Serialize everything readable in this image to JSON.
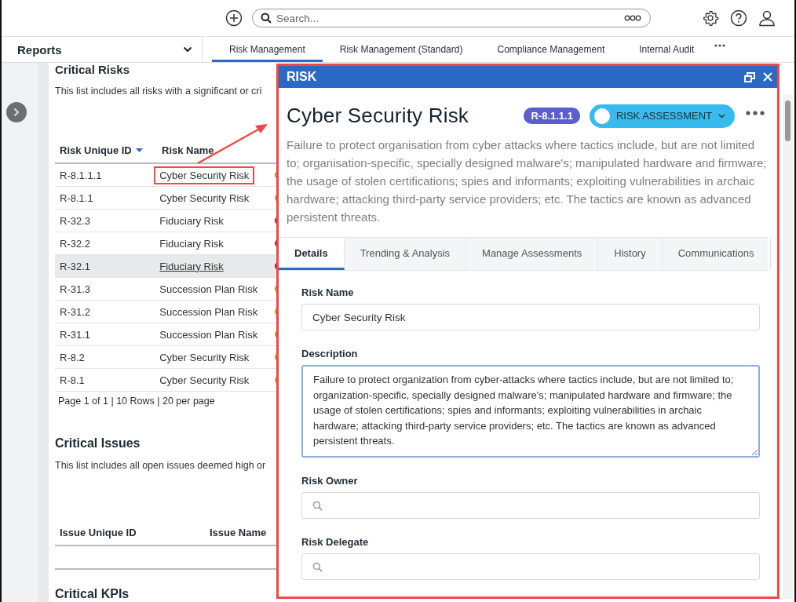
{
  "top_bar": {
    "search": {
      "placeholder": "Search..."
    }
  },
  "nav": {
    "menu": {
      "label": "Reports"
    },
    "tabs": [
      {
        "label": "Risk Management",
        "selected": true
      },
      {
        "label": "Risk Management (Standard)",
        "selected": false
      },
      {
        "label": "Compliance Management",
        "selected": false
      },
      {
        "label": "Internal Audit",
        "selected": false
      }
    ]
  },
  "critical_risks": {
    "title": "Critical Risks",
    "description": "This list includes all risks with a significant or cri",
    "columns": [
      {
        "label": "Risk Unique ID",
        "sorted": true
      },
      {
        "label": "Risk Name",
        "sorted": false
      }
    ],
    "rows": [
      {
        "id": "R-8.1.1.1",
        "name": "Cyber Security Risk",
        "color": "#f0841c",
        "selected": false,
        "annotated": true
      },
      {
        "id": "R-8.1.1",
        "name": "Cyber Security Risk",
        "color": "#f0841c",
        "selected": false,
        "annotated": false
      },
      {
        "id": "R-32.3",
        "name": "Fiduciary Risk",
        "color": "#b8102a",
        "selected": false,
        "annotated": false
      },
      {
        "id": "R-32.2",
        "name": "Fiduciary Risk",
        "color": "#b8102a",
        "selected": false,
        "annotated": false
      },
      {
        "id": "R-32.1",
        "name": "Fiduciary Risk",
        "color": "#b8102a",
        "selected": true,
        "annotated": false
      },
      {
        "id": "R-31.3",
        "name": "Succession Plan Risk",
        "color": "#f0841c",
        "selected": false,
        "annotated": false
      },
      {
        "id": "R-31.2",
        "name": "Succession Plan Risk",
        "color": "#f0841c",
        "selected": false,
        "annotated": false
      },
      {
        "id": "R-31.1",
        "name": "Succession Plan Risk",
        "color": "#f0841c",
        "selected": false,
        "annotated": false
      },
      {
        "id": "R-8.2",
        "name": "Cyber Security Risk",
        "color": "#f0841c",
        "selected": false,
        "annotated": false
      },
      {
        "id": "R-8.1",
        "name": "Cyber Security Risk",
        "color": "#f0841c",
        "selected": false,
        "annotated": false
      }
    ],
    "pager": "Page 1 of 1 | 10 Rows | 20 per page"
  },
  "critical_issues": {
    "title": "Critical Issues",
    "description": "This list includes all open issues deemed high or",
    "columns": [
      "Issue Unique ID",
      "Issue Name"
    ]
  },
  "critical_kpis": {
    "title": "Critical KPIs"
  },
  "panel": {
    "title": "RISK",
    "heading": "Cyber Security Risk",
    "badge": "R-8.1.1.1",
    "status": "RISK ASSESSMENT",
    "description": "Failure to protect organisation from cyber attacks where tactics include, but are not limited to; organisation-specific, specially designed malware's; manipulated hardware and firmware; the usage of stolen certifications; spies and informants; exploiting vulnerabilities in archaic hardware; attacking third-party service providers; etc. The tactics are known as advanced persistent threats.",
    "tabs": [
      {
        "label": "Details",
        "selected": true
      },
      {
        "label": "Trending & Analysis",
        "selected": false
      },
      {
        "label": "Manage Assessments",
        "selected": false
      },
      {
        "label": "History",
        "selected": false
      },
      {
        "label": "Communications",
        "selected": false
      }
    ],
    "fields": [
      {
        "kind": "text",
        "label": "Risk Name",
        "value": "Cyber Security Risk"
      },
      {
        "kind": "textarea",
        "label": "Description",
        "value": "Failure to protect organization from cyber-attacks where tactics include, but are not limited to; organization-specific, specially designed malware's; manipulated hardware and firmware; the usage of stolen certifications; spies and informants; exploiting vulnerabilities in archaic hardware; attacking third-party service providers; etc. The tactics are known as advanced persistent threats.",
        "focused": true
      },
      {
        "kind": "lookup",
        "label": "Risk Owner"
      },
      {
        "kind": "lookup",
        "label": "Risk Delegate"
      }
    ]
  }
}
